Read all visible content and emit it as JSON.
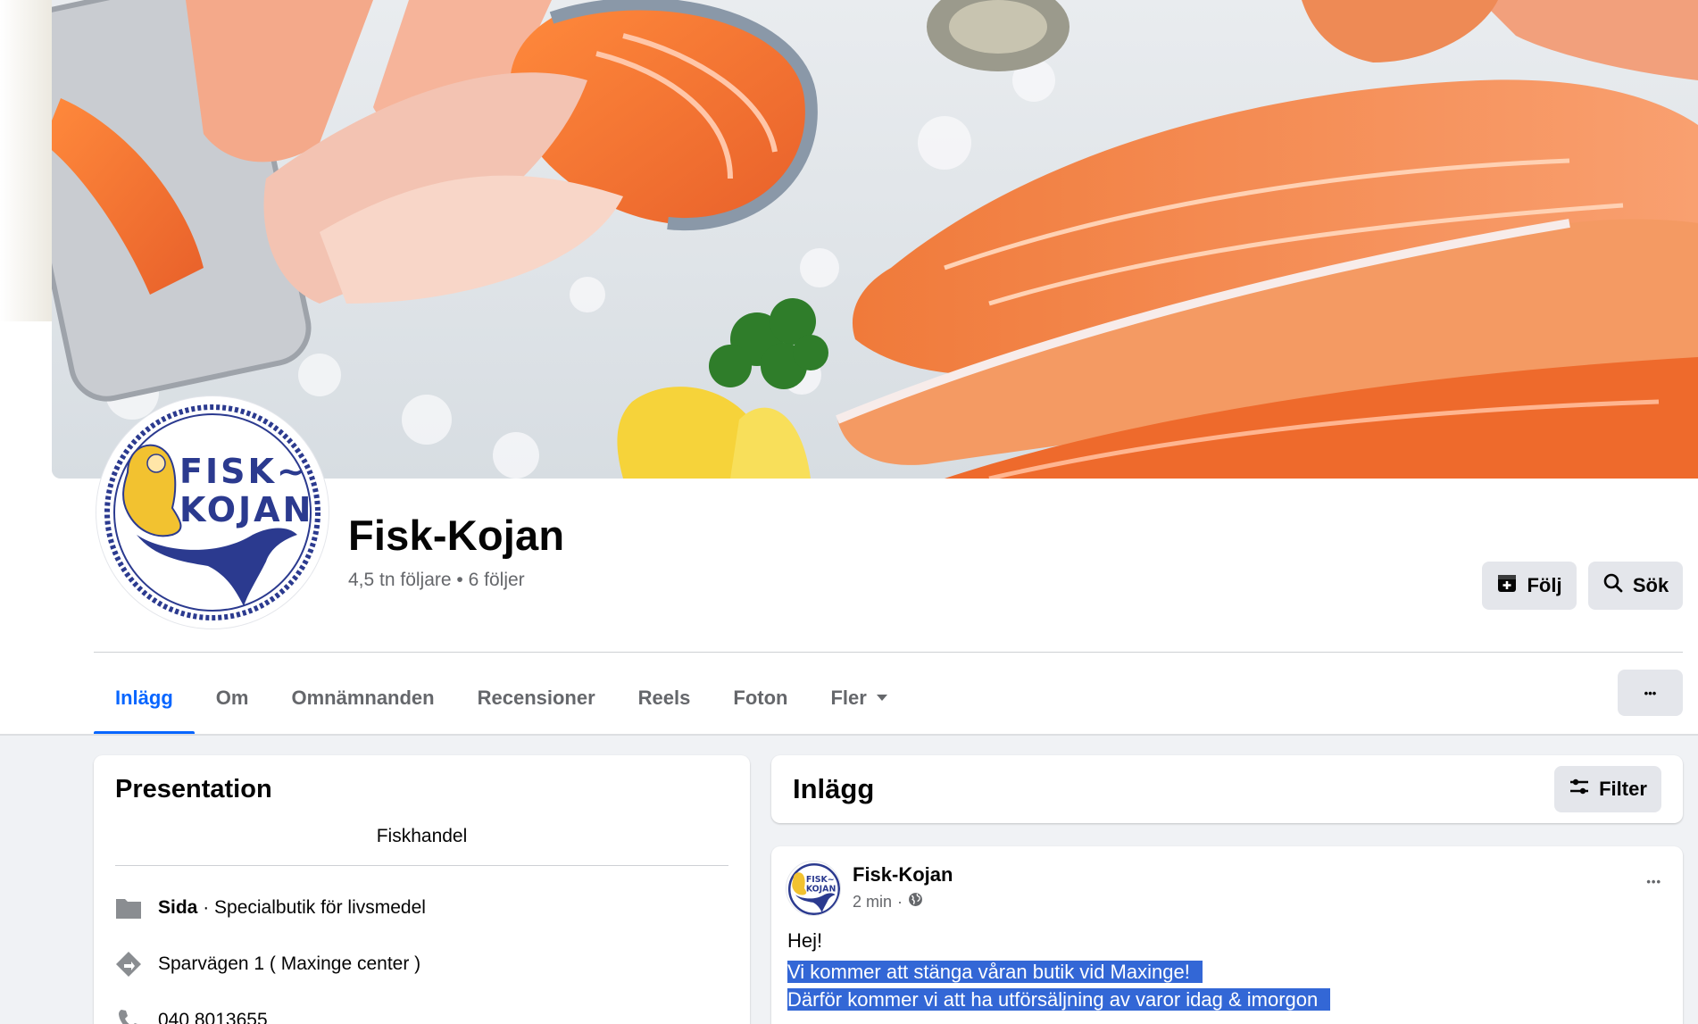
{
  "page": {
    "name": "Fisk-Kojan",
    "followers": "4,5 tn följare",
    "separator": "•",
    "following": "6 följer"
  },
  "logo": {
    "line1": "FISK~",
    "line2": "KOJAN",
    "small_line1": "FISK~",
    "small_line2": "KOJAN"
  },
  "actions": {
    "follow_label": "Följ",
    "search_label": "Sök",
    "more_label": "•••"
  },
  "tabs": [
    {
      "label": "Inlägg",
      "active": true
    },
    {
      "label": "Om"
    },
    {
      "label": "Omnämnanden"
    },
    {
      "label": "Recensioner"
    },
    {
      "label": "Reels"
    },
    {
      "label": "Foton"
    },
    {
      "label": "Fler"
    }
  ],
  "intro": {
    "title": "Presentation",
    "bio": "Fiskhandel",
    "category_bold": "Sida",
    "category_rest": " · Specialbutik för livsmedel",
    "address": "Sparvägen 1 ( Maxinge center )",
    "phone": "040 8013655"
  },
  "posts_header": {
    "title": "Inlägg",
    "filter_label": "Filter"
  },
  "post": {
    "author": "Fisk-Kojan",
    "time": "2 min",
    "meta_sep": "·",
    "dots": "•••",
    "line1": "Hej!",
    "line2": "Vi kommer att stänga våran butik vid Maxinge!",
    "line3": "Därför kommer vi att ha utförsäljning av varor idag & imorgon"
  },
  "icons": {
    "follow": "follow-icon",
    "search": "search-icon",
    "filter": "filter-icon",
    "category": "page-flag-icon",
    "address": "directions-icon",
    "phone": "phone-icon",
    "globe": "globe-icon",
    "caret": "caret-down-icon"
  },
  "colors": {
    "accent": "#0866ff",
    "logo_blue": "#2b3a8f",
    "logo_gold": "#f2c230",
    "highlight": "#3367d6"
  }
}
